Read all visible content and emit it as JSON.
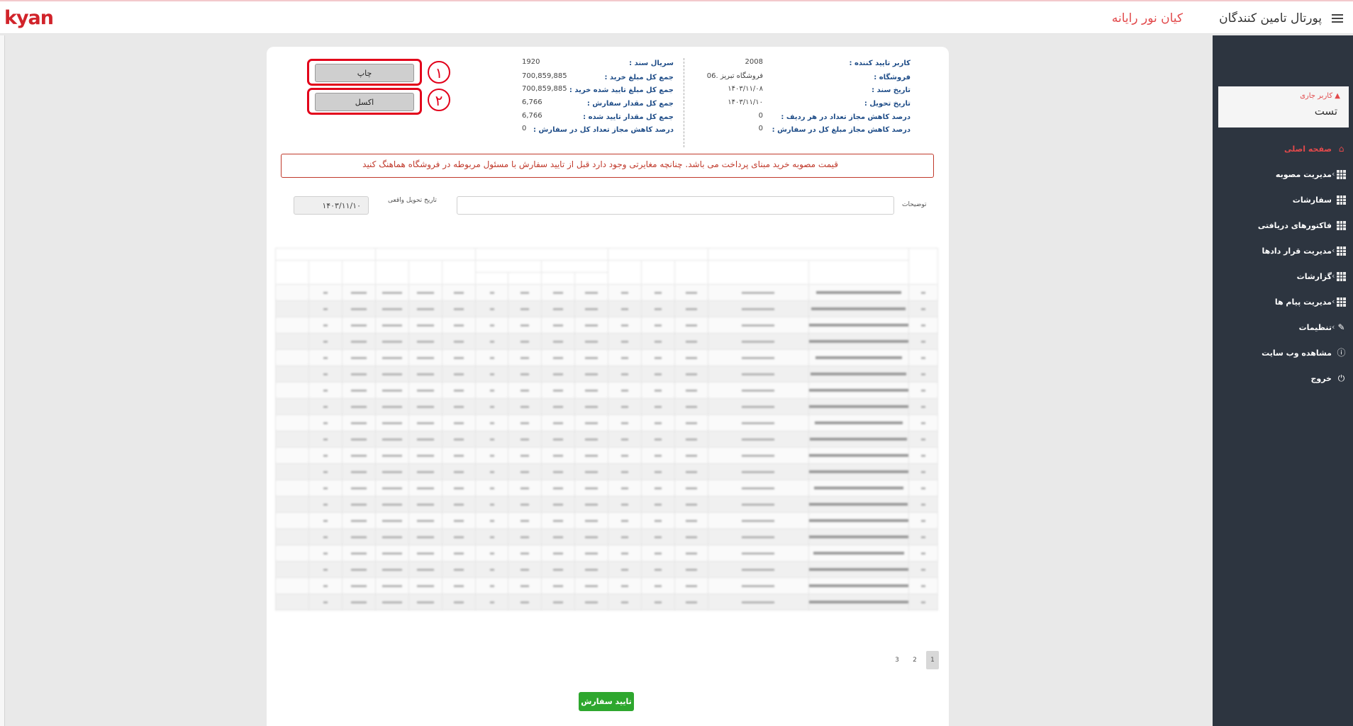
{
  "header": {
    "logo_text": "kyan",
    "portal_title": "پورتال تامین کنندگان",
    "company_name": "کیان نور رایانه"
  },
  "sidebar": {
    "user_label": "کاربر جاری",
    "user_name": "تست",
    "items": [
      {
        "label": "صفحه اصلی",
        "icon": "home-icon",
        "active": true,
        "submenu": false
      },
      {
        "label": "مدیریت مصوبه",
        "icon": "grid-icon",
        "active": false,
        "submenu": true
      },
      {
        "label": "سفارشات",
        "icon": "grid-icon",
        "active": false,
        "submenu": false
      },
      {
        "label": "فاکتورهای دریافتی",
        "icon": "grid-icon",
        "active": false,
        "submenu": false
      },
      {
        "label": "مدیریت قرار دادها",
        "icon": "grid-icon",
        "active": false,
        "submenu": true
      },
      {
        "label": "گزارشات",
        "icon": "grid-icon",
        "active": false,
        "submenu": true
      },
      {
        "label": "مدیریت پیام ها",
        "icon": "grid-icon",
        "active": false,
        "submenu": true
      },
      {
        "label": "تنظیمات",
        "icon": "edit-icon",
        "active": false,
        "submenu": true
      },
      {
        "label": "مشاهده وب سایت",
        "icon": "info-icon",
        "active": false,
        "submenu": false
      },
      {
        "label": "خروج",
        "icon": "power-icon",
        "active": false,
        "submenu": false
      }
    ]
  },
  "order_info": {
    "right_column": [
      {
        "label": "کاربر تایید کننده :",
        "value": "2008"
      },
      {
        "label": "فروشگاه :",
        "value": "06. فروشگاه تبریز"
      },
      {
        "label": "تاریخ سند :",
        "value": "۱۴۰۳/۱۱/۰۸"
      },
      {
        "label": "تاریخ تحویل :",
        "value": "۱۴۰۳/۱۱/۱۰"
      },
      {
        "label": "درصد کاهش مجاز تعداد در هر ردیف :",
        "value": "0"
      },
      {
        "label": "درصد کاهش مجاز مبلغ کل در سفارش :",
        "value": "0"
      }
    ],
    "left_column": [
      {
        "label": "سریال سند :",
        "value": "1920"
      },
      {
        "label": "جمع کل مبلغ خرید :",
        "value": "700,859,885"
      },
      {
        "label": "جمع کل مبلغ تایید شده خرید :",
        "value": "700,859,885"
      },
      {
        "label": "جمع کل مقدار سفارش :",
        "value": "6,766"
      },
      {
        "label": "جمع کل مقدار تایید شده :",
        "value": "6,766"
      },
      {
        "label": "درصد کاهش مجاز تعداد کل در سفارش :",
        "value": "0"
      }
    ]
  },
  "actions": {
    "print_label": "چاپ",
    "excel_label": "اکسل",
    "annotation_1": "۱",
    "annotation_2": "۲",
    "confirm_label": "تایید سفارش"
  },
  "alert_text": "قیمت مصوبه خرید مبنای پرداخت می باشد. چنانچه مغایرتی وجود دارد قبل از تایید سفارش با مسئول مربوطه در فروشگاه هماهنگ کنید",
  "form": {
    "notes_label": "توضیحات",
    "notes_value": "",
    "delivery_label": "تاریخ تحویل واقعی",
    "delivery_value": "۱۴۰۳/۱۱/۱۰"
  },
  "pagination": {
    "pages": [
      "1",
      "2",
      "3"
    ],
    "current": "1"
  }
}
